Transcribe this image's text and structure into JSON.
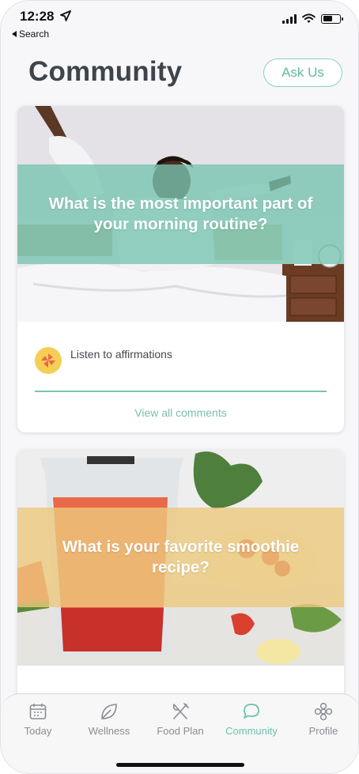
{
  "status": {
    "time": "12:28",
    "back_label": "Search"
  },
  "header": {
    "title": "Community",
    "ask_label": "Ask Us"
  },
  "posts": [
    {
      "question": "What is the most important part of your morning routine?",
      "comment": {
        "text": "Listen to affirmations",
        "avatar_icon": "pinwheel-icon"
      },
      "view_all_label": "View all comments",
      "band_color": "#76c4af"
    },
    {
      "question": "What is your favorite smoothie recipe?",
      "band_color": "#ecc87d"
    }
  ],
  "tabs": [
    {
      "label": "Today",
      "icon": "calendar-icon",
      "active": false
    },
    {
      "label": "Wellness",
      "icon": "leaf-icon",
      "active": false
    },
    {
      "label": "Food Plan",
      "icon": "fork-knife-icon",
      "active": false
    },
    {
      "label": "Community",
      "icon": "chat-bubble-icon",
      "active": true
    },
    {
      "label": "Profile",
      "icon": "flower-icon",
      "active": false
    }
  ],
  "colors": {
    "accent": "#6cbfa9",
    "title": "#3e444c",
    "inactive": "#8a8d93"
  }
}
